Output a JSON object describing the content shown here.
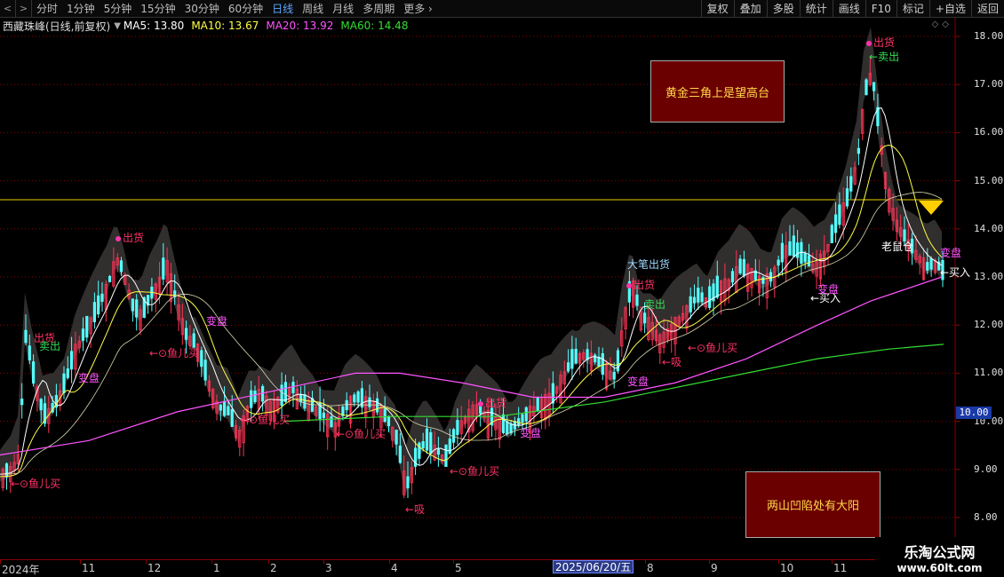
{
  "toolbar": {
    "periods": [
      "分时",
      "1分钟",
      "5分钟",
      "15分钟",
      "30分钟",
      "60分钟",
      "日线",
      "周线",
      "月线",
      "多周期",
      "更多"
    ],
    "active_period": "日线",
    "right_tools": [
      "复权",
      "叠加",
      "多股",
      "统计",
      "画线",
      "F10",
      "标记",
      "+自选",
      "返回"
    ]
  },
  "info": {
    "title": "西藏珠峰(日线,前复权)",
    "ma5": "MA5: 13.80",
    "ma10": "MA10: 13.67",
    "ma20": "MA20: 13.92",
    "ma60": "MA60: 14.48"
  },
  "colors": {
    "up": "#ff3355",
    "down": "#55ffff",
    "ma5": "#ffffff",
    "ma10": "#ffff44",
    "ma20": "#ff55ff",
    "ma60": "#33dd33",
    "grid": "#8b0000"
  },
  "price_axis": {
    "labels": [
      "18.00",
      "17.00",
      "16.00",
      "15.00",
      "14.00",
      "13.00",
      "12.00",
      "11.00",
      "10.00",
      "9.00",
      "8.00"
    ],
    "current": "10.00"
  },
  "notes": {
    "box1": "黄金三角上是望高台",
    "box2": "两山凹陷处有大阳"
  },
  "signals": {
    "sell": "出货",
    "sell_cyan": "大笔出货",
    "sell_green": "卖出",
    "buy": "←⊙鱼儿买",
    "absorb": "←吸",
    "buy_in": "←买入",
    "old_mouse": "老鼠仓",
    "variation": "变盘"
  },
  "time_axis": {
    "labels": [
      "2024年",
      "11",
      "12",
      "1",
      "2",
      "3",
      "4",
      "5",
      "8",
      "9",
      "10",
      "11"
    ],
    "cursor": "2025/06/20/五"
  },
  "watermark": {
    "line1": "乐淘公式网",
    "line2": "www.60lt.com"
  }
}
